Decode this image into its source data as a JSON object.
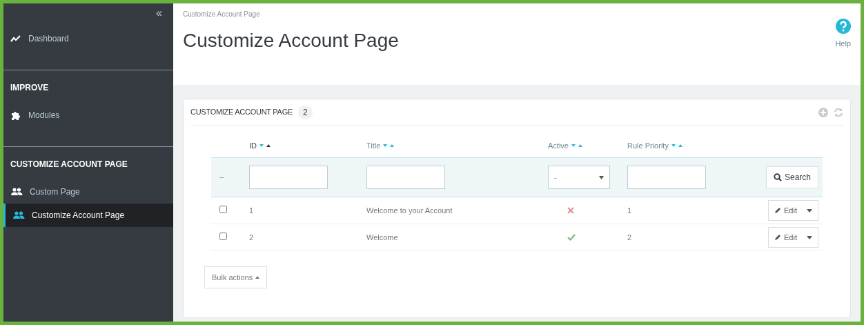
{
  "sidebar": {
    "collapse": "«",
    "sections": [
      {
        "items": [
          {
            "label": "Dashboard",
            "kind": "chart",
            "selected": false
          }
        ]
      },
      {
        "heading": "IMPROVE",
        "items": [
          {
            "label": "Modules",
            "kind": "puzzle",
            "selected": false
          }
        ]
      },
      {
        "heading": "CUSTOMIZE ACCOUNT PAGE",
        "items": [
          {
            "label": "Custom Page",
            "kind": "users",
            "selected": false
          },
          {
            "label": "Customize Account Page",
            "kind": "users",
            "selected": true
          }
        ]
      }
    ]
  },
  "breadcrumb": "Customize Account Page",
  "page_title": "Customize Account Page",
  "help": "Help",
  "panel": {
    "title": "CUSTOMIZE ACCOUNT PAGE",
    "count": "2",
    "columns": [
      {
        "label": "ID",
        "sort_asc_active": true
      },
      {
        "label": "Title",
        "sort_asc_active": false
      },
      {
        "label": "Active",
        "sort_asc_active": false
      },
      {
        "label": "Rule Priority",
        "sort_asc_active": false
      }
    ],
    "filter": {
      "dash": "–",
      "select_value": "-",
      "search": "Search"
    },
    "rows": [
      {
        "checked": false,
        "id": "1",
        "title": "Welcome to your Account",
        "active": false,
        "priority": "1",
        "action": "Edit"
      },
      {
        "checked": false,
        "id": "2",
        "title": "Welcome",
        "active": true,
        "priority": "2",
        "action": "Edit"
      }
    ],
    "bulk": "Bulk actions"
  }
}
